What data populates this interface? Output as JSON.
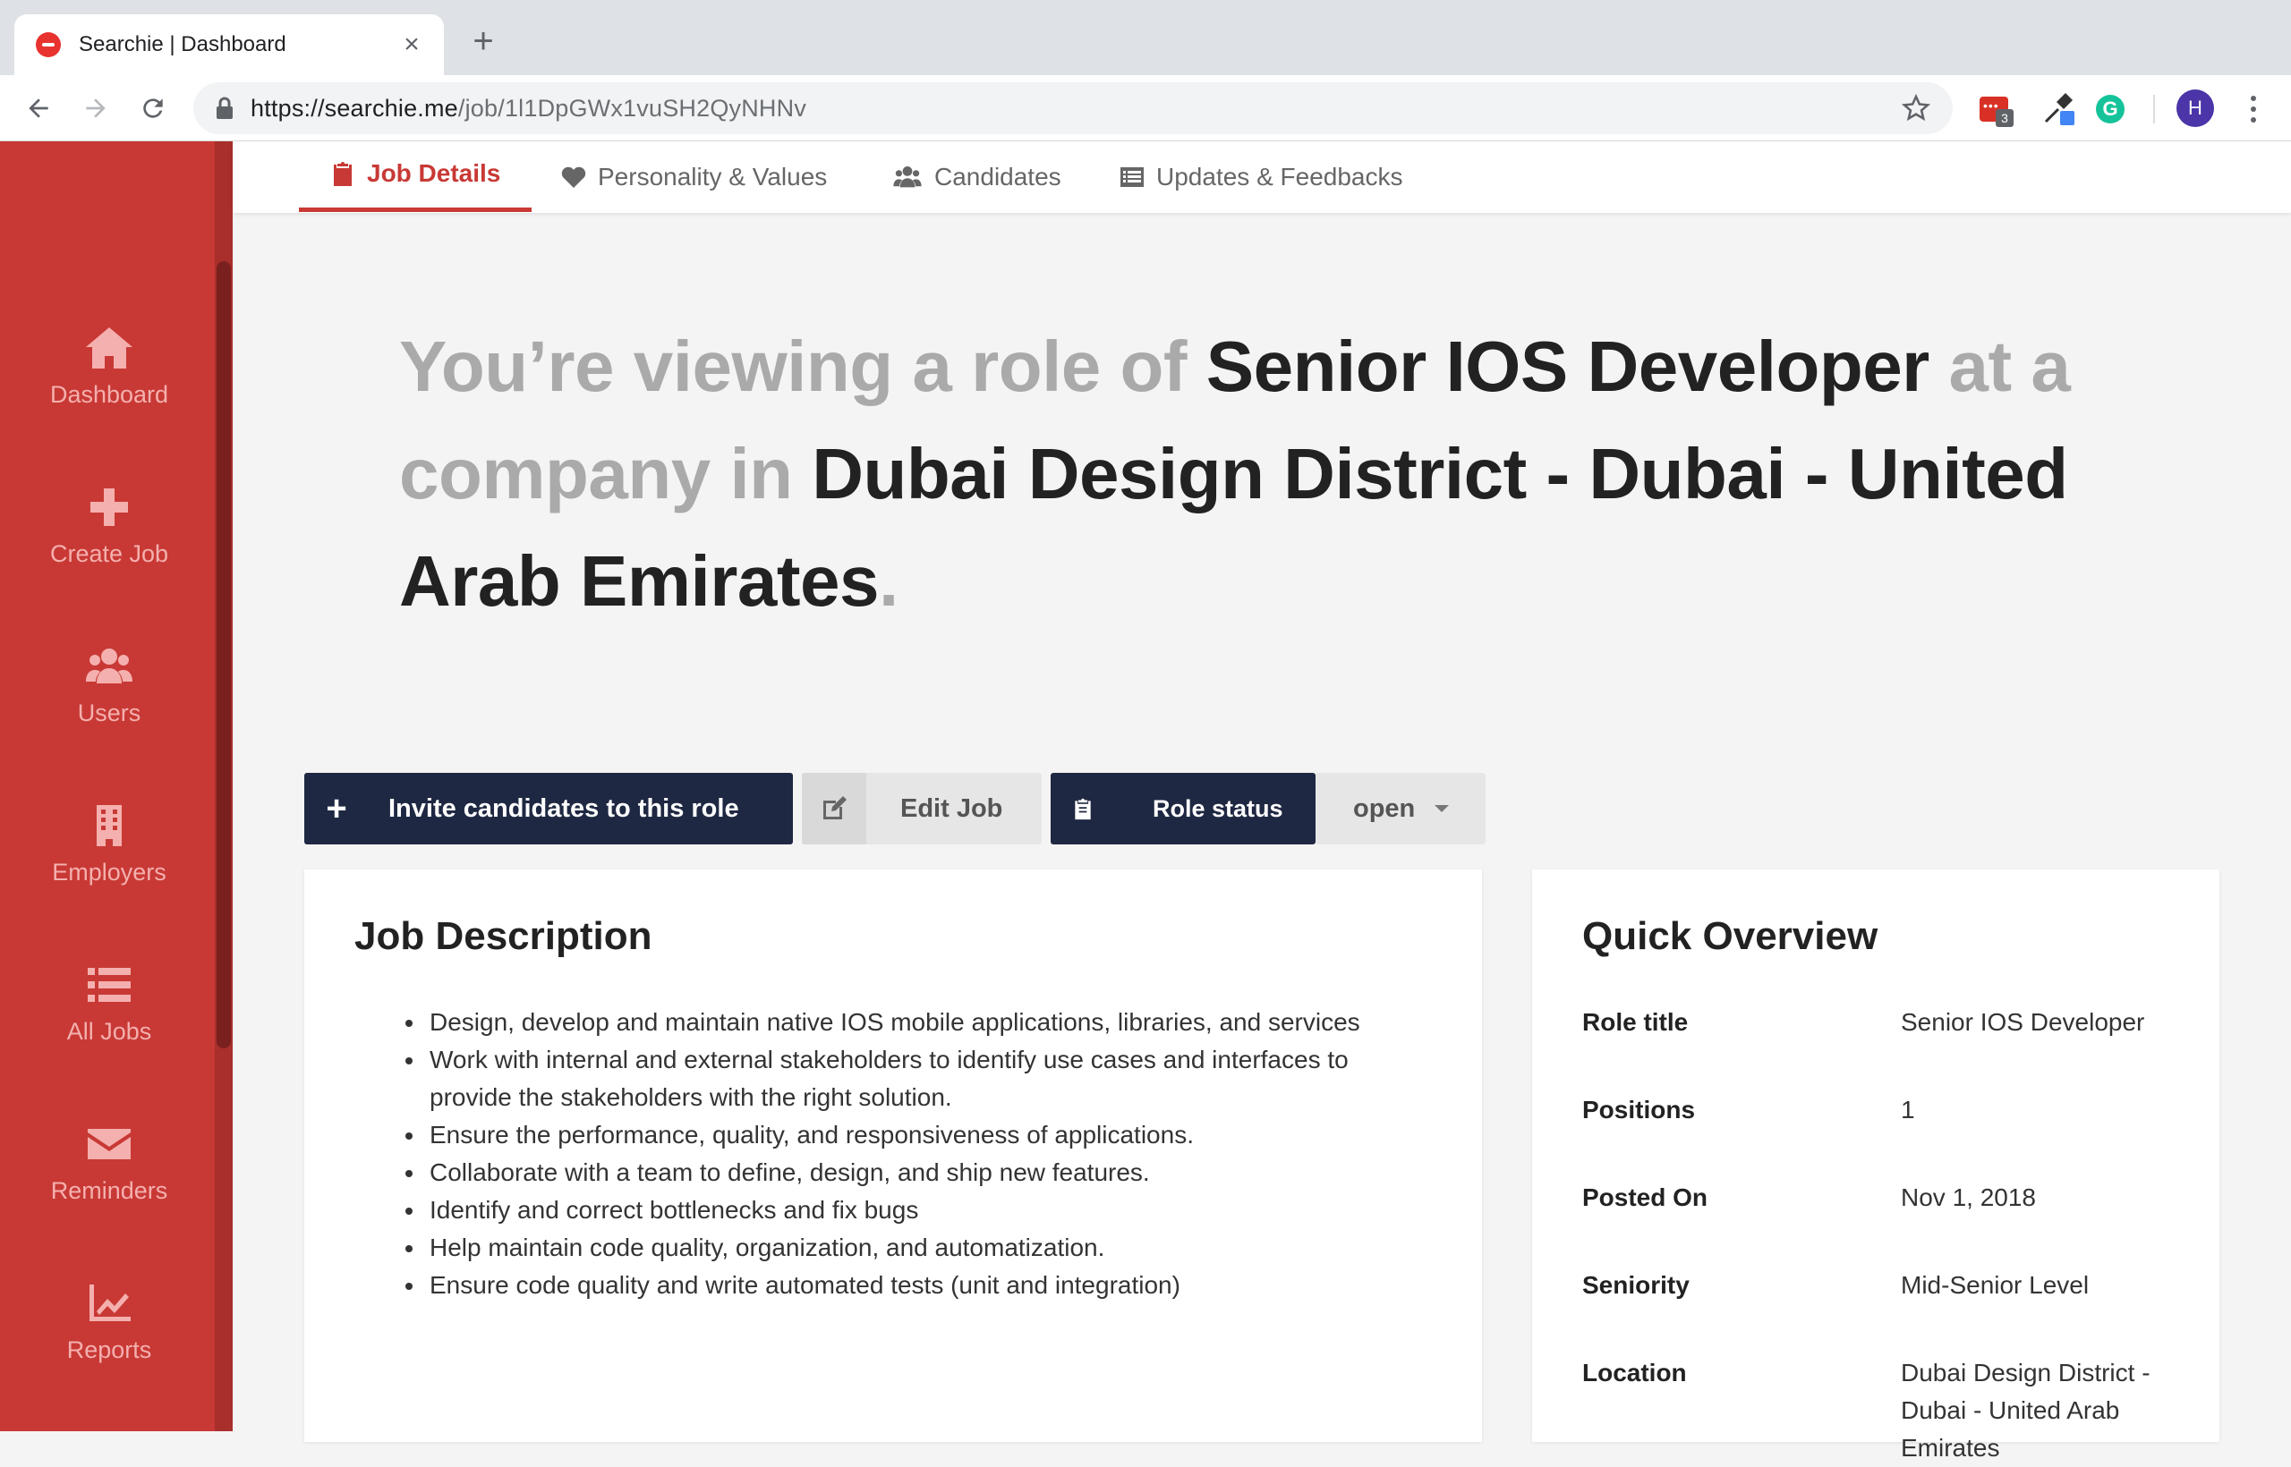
{
  "browser": {
    "tab_title": "Searchie | Dashboard",
    "url_host": "https://searchie.me",
    "url_path": "/job/1l1DpGWx1vuSH2QyNHNv",
    "extension_badge": "3",
    "profile_initial": "H"
  },
  "sidebar": {
    "items": [
      {
        "label": "Dashboard",
        "icon": "home-icon"
      },
      {
        "label": "Create Job",
        "icon": "plus-icon"
      },
      {
        "label": "Users",
        "icon": "users-icon"
      },
      {
        "label": "Employers",
        "icon": "building-icon"
      },
      {
        "label": "All Jobs",
        "icon": "list-icon"
      },
      {
        "label": "Reminders",
        "icon": "envelope-icon"
      },
      {
        "label": "Reports",
        "icon": "chart-icon"
      }
    ]
  },
  "tabs": [
    {
      "label": "Job Details",
      "icon": "clipboard-icon",
      "active": true
    },
    {
      "label": "Personality & Values",
      "icon": "heart-icon",
      "active": false
    },
    {
      "label": "Candidates",
      "icon": "users-icon",
      "active": false
    },
    {
      "label": "Updates & Feedbacks",
      "icon": "list-alt-icon",
      "active": false
    }
  ],
  "headline": {
    "prefix": "You’re viewing a role of ",
    "role": "Senior IOS Developer",
    "middle": " at a company in ",
    "location": "Dubai Design District - Dubai - United Arab Emirates",
    "suffix": "."
  },
  "actions": {
    "invite_label": "Invite candidates to this role",
    "edit_label": "Edit Job",
    "status_label": "Role status",
    "status_value": "open"
  },
  "job_description": {
    "title": "Job Description",
    "items": [
      "Design, develop and maintain native IOS mobile applications, libraries, and services",
      "Work with internal and external stakeholders to identify use cases and interfaces to provide the stakeholders with the right solution.",
      "Ensure the performance, quality, and responsiveness of applications.",
      "Collaborate with a team to define, design, and ship new features.",
      "Identify and correct bottlenecks and fix bugs",
      "Help maintain code quality, organization, and automatization.",
      "Ensure code quality and write automated tests (unit and integration)"
    ]
  },
  "quick_overview": {
    "title": "Quick Overview",
    "rows": [
      {
        "key": "Role title",
        "value": "Senior IOS Developer"
      },
      {
        "key": "Positions",
        "value": "1"
      },
      {
        "key": "Posted On",
        "value": "Nov 1, 2018"
      },
      {
        "key": "Seniority",
        "value": "Mid-Senior Level"
      },
      {
        "key": "Location",
        "value": "Dubai Design District - Dubai - United Arab Emirates"
      }
    ]
  },
  "colors": {
    "brand_red": "#c83935",
    "navy": "#1f2842",
    "muted_text": "#aaaaaa"
  }
}
